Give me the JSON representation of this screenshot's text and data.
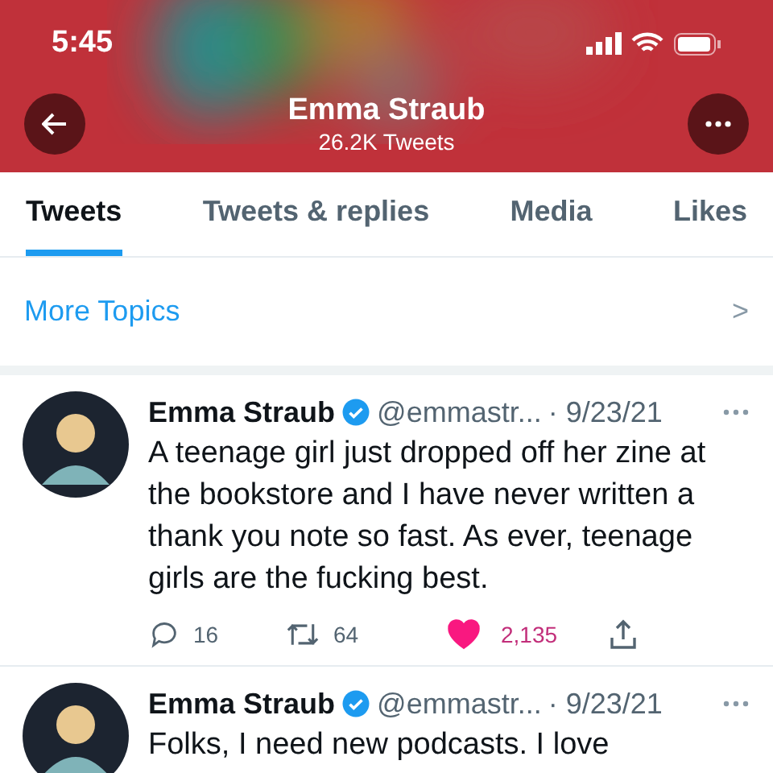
{
  "status_bar": {
    "time": "5:45"
  },
  "header": {
    "kind": "picture",
    "name": "Emma Straub",
    "count": "26.2K Tweets"
  },
  "tabs": [
    {
      "label": "Tweets",
      "selected": true
    },
    {
      "label": "Tweets & replies",
      "selected": false
    },
    {
      "label": "Media",
      "selected": false
    },
    {
      "label": "Likes",
      "selected": false
    }
  ],
  "more_topics": {
    "label": "More Topics",
    "chevron": ">"
  },
  "tweets": [
    {
      "name": "Emma Straub",
      "verified": true,
      "handle": "@emmastr...",
      "date": "· 9/23/21",
      "text": "A teenage girl just dropped off her zine at the bookstore and I have never written a thank you note so fast. As ever, teenage girls are the fucking best.",
      "actions": {
        "replies": "16",
        "retweets": "64",
        "retweeted": false,
        "likes": "2,135",
        "liked": true
      }
    },
    {
      "name": "Emma Straub",
      "verified": true,
      "handle": "@emmastr...",
      "date": "· 9/23/21",
      "text": "Folks, I need new podcasts. I love"
    }
  ]
}
